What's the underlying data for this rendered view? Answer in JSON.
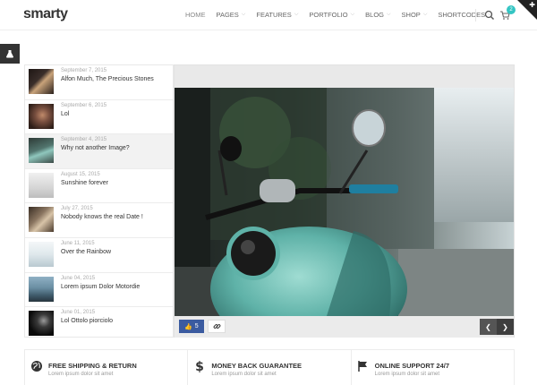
{
  "header": {
    "logo": "smarty",
    "nav": [
      {
        "label": "HOME",
        "active": true
      },
      {
        "label": "PAGES"
      },
      {
        "label": "FEATURES"
      },
      {
        "label": "PORTFOLIO"
      },
      {
        "label": "BLOG"
      },
      {
        "label": "SHOP"
      },
      {
        "label": "SHORTCODES"
      }
    ],
    "cart_count": "2"
  },
  "posts": [
    {
      "date": "September 7, 2015",
      "title": "Alfon Much, The Precious Stones",
      "thumb_color": "#3a2e2a"
    },
    {
      "date": "September 6, 2015",
      "title": "Lol",
      "thumb_color": "#5a3f35"
    },
    {
      "date": "September 4, 2015",
      "title": "Why not another Image?",
      "thumb_color": "#4d6b6b",
      "active": true
    },
    {
      "date": "August 15, 2015",
      "title": "Sunshine forever",
      "thumb_color": "#d8d8d8"
    },
    {
      "date": "July 27, 2015",
      "title": "Nobody knows the real Date !",
      "thumb_color": "#6a5a4a"
    },
    {
      "date": "June 11, 2015",
      "title": "Over the Rainbow",
      "thumb_color": "#e4ecef"
    },
    {
      "date": "June 04, 2015",
      "title": "Lorem ipsum Dolor Motordie",
      "thumb_color": "#5f7f92"
    },
    {
      "date": "June 01, 2015",
      "title": "Lol Ottolo piorciolo",
      "thumb_color": "#1a1a1a"
    }
  ],
  "slider": {
    "likes": "5"
  },
  "features": [
    {
      "title": "FREE SHIPPING & RETURN",
      "sub": "Lorem ipsum dolor sit amet",
      "icon": "globe-icon"
    },
    {
      "title": "MONEY BACK GUARANTEE",
      "sub": "Lorem ipsum dolor sit amet",
      "icon": "dollar-icon"
    },
    {
      "title": "ONLINE SUPPORT 24/7",
      "sub": "Lorem ipsum dolor sit amet",
      "icon": "flag-icon"
    }
  ],
  "colors": {
    "accent": "#34c5c3",
    "facebook": "#3b5ba0",
    "dark": "#333333"
  }
}
